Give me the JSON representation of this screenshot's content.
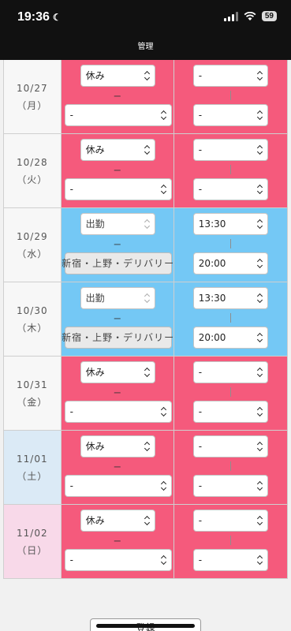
{
  "status": {
    "time": "19:36",
    "battery": "59"
  },
  "header": {
    "title": "管理"
  },
  "rows": [
    {
      "date": "10/27",
      "day": "（月）",
      "kind": "weekday",
      "status": "休み",
      "area": "-",
      "start": "-",
      "end": "-"
    },
    {
      "date": "10/28",
      "day": "（火）",
      "kind": "weekday",
      "status": "休み",
      "area": "-",
      "start": "-",
      "end": "-"
    },
    {
      "date": "10/29",
      "day": "（水）",
      "kind": "weekday",
      "status": "出勤",
      "area": "新宿・上野・デリバリー",
      "start": "13:30",
      "end": "20:00"
    },
    {
      "date": "10/30",
      "day": "（木）",
      "kind": "weekday",
      "status": "出勤",
      "area": "新宿・上野・デリバリー",
      "start": "13:30",
      "end": "20:00"
    },
    {
      "date": "10/31",
      "day": "（金）",
      "kind": "weekday",
      "status": "休み",
      "area": "-",
      "start": "-",
      "end": "-"
    },
    {
      "date": "11/01",
      "day": "（土）",
      "kind": "saturday",
      "status": "休み",
      "area": "-",
      "start": "-",
      "end": "-"
    },
    {
      "date": "11/02",
      "day": "（日）",
      "kind": "sunday",
      "status": "休み",
      "area": "-",
      "start": "-",
      "end": "-"
    }
  ],
  "labels": {
    "dash": "ー",
    "submit": "登録"
  }
}
